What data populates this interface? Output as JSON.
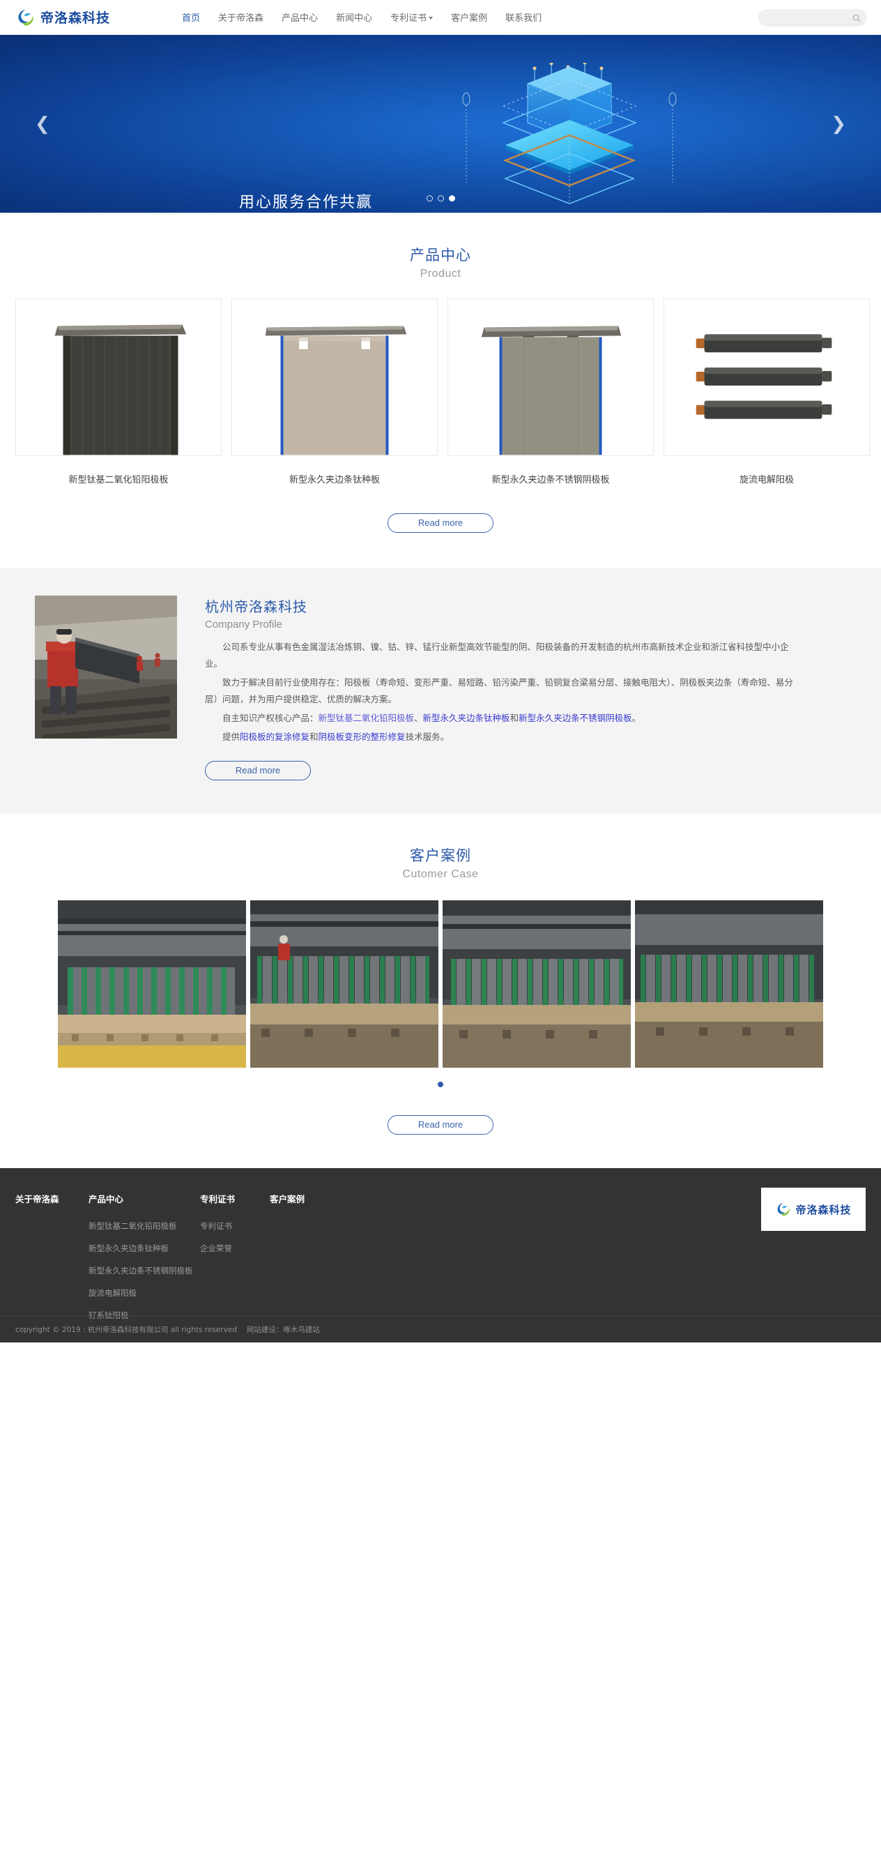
{
  "brand": {
    "name": "帝洛森科技",
    "logo_icon": "swirl-logo-icon"
  },
  "header": {
    "nav": [
      {
        "label": "首页",
        "active": true,
        "caret": false
      },
      {
        "label": "关于帝洛森",
        "active": false,
        "caret": false
      },
      {
        "label": "产品中心",
        "active": false,
        "caret": false
      },
      {
        "label": "新闻中心",
        "active": false,
        "caret": false
      },
      {
        "label": "专利证书",
        "active": false,
        "caret": true
      },
      {
        "label": "客户案例",
        "active": false,
        "caret": false
      },
      {
        "label": "联系我们",
        "active": false,
        "caret": false
      }
    ],
    "search": {
      "value": "",
      "placeholder": "",
      "icon": "search-icon"
    }
  },
  "hero": {
    "title": "用心服务合作共赢",
    "prev_icon": "chevron-left-icon",
    "next_icon": "chevron-right-icon",
    "dots": [
      {
        "active": false
      },
      {
        "active": false
      },
      {
        "active": true
      }
    ]
  },
  "products": {
    "title_cn": "产品中心",
    "title_en": "Product",
    "items": [
      {
        "name": "新型钛基二氧化铅阳极板",
        "image": "anode-plate-dark-photo"
      },
      {
        "name": "新型永久夹边条钛种板",
        "image": "titanium-seed-plate-photo"
      },
      {
        "name": "新型永久夹边条不锈钢阴极板",
        "image": "stainless-cathode-plate-photo"
      },
      {
        "name": "旋流电解阳极",
        "image": "cyclone-electrolysis-anode-photo"
      }
    ],
    "read_more": "Read more"
  },
  "company": {
    "title_cn": "杭州帝洛森科技",
    "title_en": "Company Profile",
    "photo": "factory-worker-photo",
    "paragraphs": [
      "公司系专业从事有色金属湿法冶炼铜、镍、钴、锌、锰行业新型高效节能型的阴、阳极装备的开发制造的杭州市高新技术企业和浙江省科技型中小企业。",
      "致力于解决目前行业使用存在：阳极板（寿命短、变形严重、易短路、铅污染严重、铅铜复合梁易分层、接触电阻大）、阴极板夹边条（寿命短、易分层）问题，并为用户提供稳定、优质的解决方案。"
    ],
    "line3": {
      "prefix": "自主知识产权核心产品：",
      "link1": "新型钛基二氧化铅阳极板",
      "mid1": "、",
      "link2": "新型永久夹边条钛种板",
      "mid2": "和",
      "link3": "新型永久夹边条不锈钢阴极板",
      "suffix": "。"
    },
    "line4": {
      "prefix": "提供",
      "link1": "阳极板的复涂修复",
      "mid": "和",
      "link2": "阴极板变形的整形修复",
      "suffix": "技术服务。"
    },
    "read_more": "Read more"
  },
  "cases": {
    "title_cn": "客户案例",
    "title_en": "Cutomer Case",
    "items": [
      {
        "image": "electrolysis-workshop-photo-1"
      },
      {
        "image": "electrolysis-workshop-photo-2"
      },
      {
        "image": "electrolysis-workshop-photo-3"
      },
      {
        "image": "electrolysis-workshop-photo-4"
      }
    ],
    "dots": [
      {
        "active": true
      }
    ],
    "read_more": "Read more"
  },
  "footer": {
    "columns": [
      {
        "title": "关于帝洛森",
        "links": []
      },
      {
        "title": "产品中心",
        "links": [
          "新型钛基二氧化铅阳极板",
          "新型永久夹边条钛种板",
          "新型永久夹边条不锈钢阴极板",
          "旋流电解阳极",
          "钌系钛阳极"
        ]
      },
      {
        "title": "专利证书",
        "links": [
          "专利证书",
          "企业荣誉"
        ]
      },
      {
        "title": "客户案例",
        "links": []
      }
    ],
    "copyright_a": "copyright © 2019 : 杭州帝洛森科技有限公司 all rights reserved",
    "copyright_b": "网站建设：啄木鸟建站"
  },
  "colors": {
    "accent": "#2b5bab",
    "link": "#3a3ad0",
    "hero_blue": "#1558b4",
    "footer_bg": "#333333",
    "panel_bg": "#f4f4f4"
  }
}
